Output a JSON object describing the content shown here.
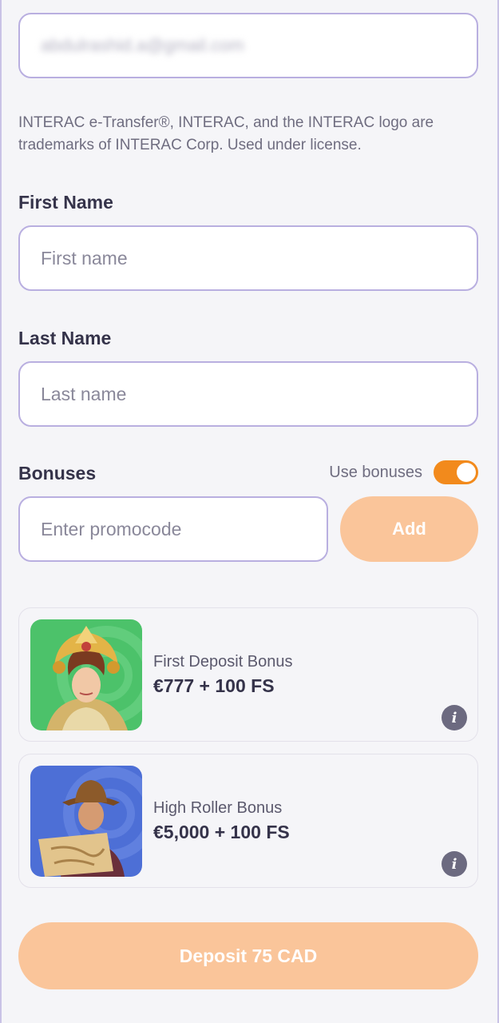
{
  "email": {
    "value": "abdulrashid.a@gmail.com"
  },
  "notice": "INTERAC e-Transfer®, INTERAC, and the INTERAC logo are trademarks of INTERAC Corp. Used under license.",
  "first_name": {
    "label": "First Name",
    "placeholder": "First name"
  },
  "last_name": {
    "label": "Last Name",
    "placeholder": "Last name"
  },
  "bonuses": {
    "label": "Bonuses",
    "toggle_label": "Use bonuses",
    "toggle_on": true,
    "promo_placeholder": "Enter promocode",
    "add_label": "Add",
    "items": [
      {
        "title": "First Deposit Bonus",
        "amount": "€777 + 100 FS",
        "info_glyph": "i",
        "thumb": "goddess-slot-art"
      },
      {
        "title": "High Roller Bonus",
        "amount": "€5,000 + 100 FS",
        "info_glyph": "i",
        "thumb": "explorer-slot-art"
      }
    ]
  },
  "deposit_button": "Deposit 75 CAD",
  "colors": {
    "accent": "#f28a1c",
    "button_disabled": "#fac59a",
    "field_border": "#b9afe0",
    "text": "#35334a"
  }
}
